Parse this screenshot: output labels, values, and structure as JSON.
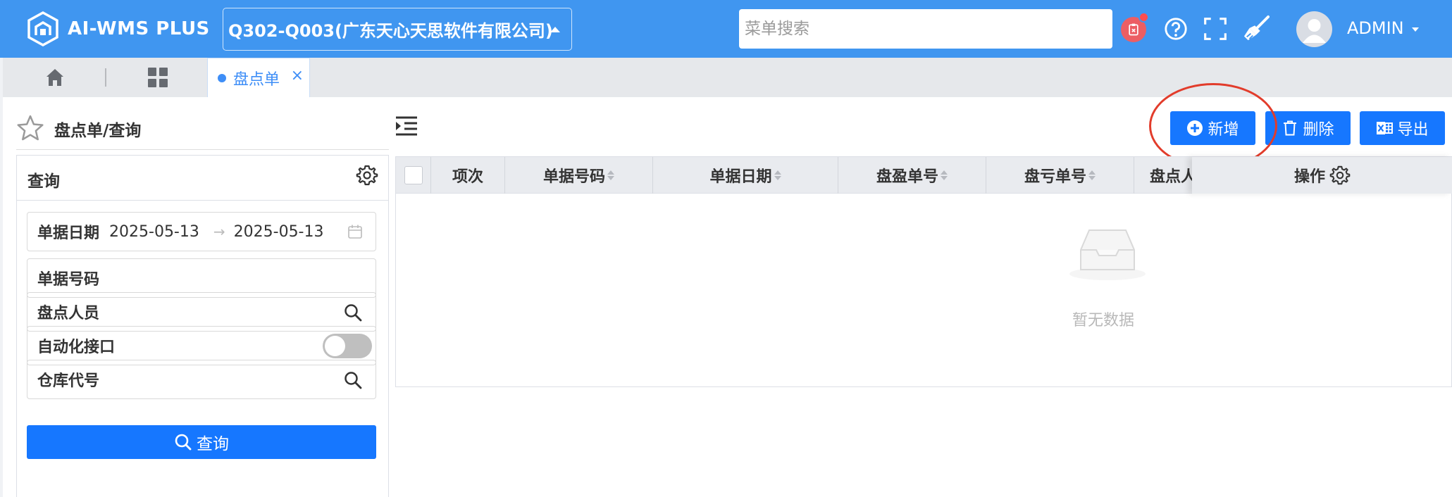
{
  "header": {
    "app_title": "AI-WMS PLUS",
    "company_selector": "Q302-Q003(广东天心天思软件有限公司)",
    "menu_search_placeholder": "菜单搜索",
    "user_name": "ADMIN",
    "brand_color": "#4096f0"
  },
  "tabs": {
    "home_icon": "home-icon",
    "grid_icon": "grid-icon",
    "active_tab": "盘点单",
    "active_color": "#3e8ef7"
  },
  "page": {
    "title": "盘点单/查询"
  },
  "search_panel": {
    "title": "查询",
    "fields": {
      "date": {
        "label": "单据日期",
        "start": "2025-05-13",
        "end": "2025-05-13"
      },
      "doc_no": {
        "label": "单据号码"
      },
      "counter": {
        "label": "盘点人员"
      },
      "auto_interface": {
        "label": "自动化接口",
        "enabled": false
      },
      "warehouse": {
        "label": "仓库代号"
      }
    },
    "query_button": "查询"
  },
  "actions": {
    "add": "新增",
    "delete": "删除",
    "export": "导出",
    "primary_color": "#1677ff",
    "annotation_color": "#e23c2b"
  },
  "table": {
    "columns": [
      "项次",
      "单据号码",
      "单据日期",
      "盘盈单号",
      "盘亏单号",
      "盘点人"
    ],
    "columns_visible": [
      "项次",
      "单据号码",
      "单据日期",
      "盘盈单号",
      "盘亏单号",
      "盘点人"
    ],
    "op_column": "操作",
    "empty_text": "暂无数据",
    "rows": []
  }
}
